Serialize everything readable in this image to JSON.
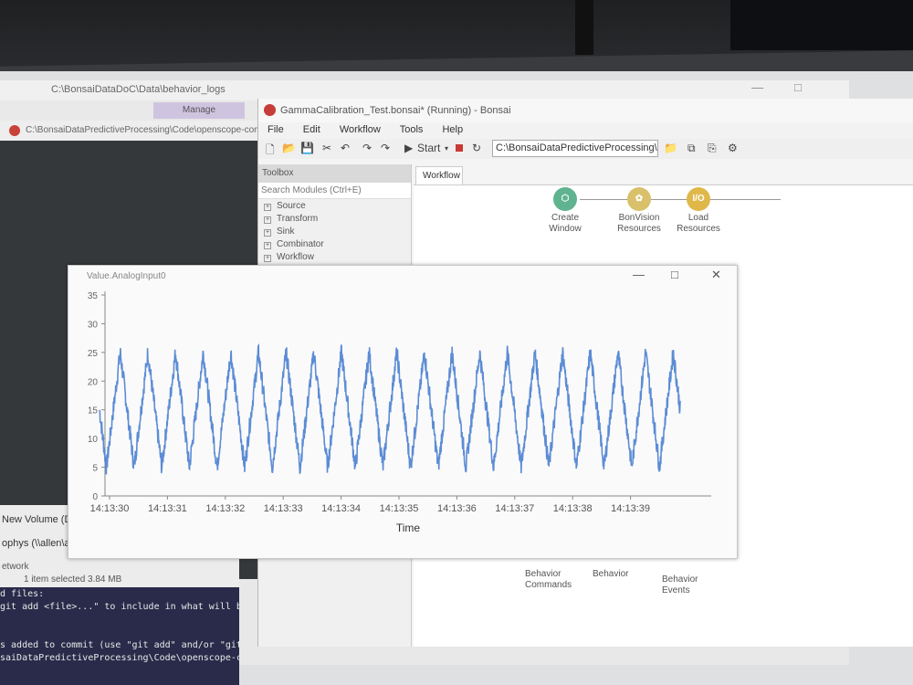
{
  "explorer_back": {
    "path": "C:\\BonsaiDataDoC\\Data\\behavior_logs",
    "manage_tab": "Manage"
  },
  "vscode": {
    "title": "C:\\BonsaiDataPredictiveProcessing\\Code\\openscope-comm"
  },
  "left_panel": {
    "volume": "New Volume (D:",
    "share": "ophys (\\\\allen\\a",
    "network": "etwork",
    "status": "1 item selected  3.84 MB"
  },
  "terminal": {
    "lines": [
      "d files:",
      "git add <file>...\" to include in what will be",
      "",
      "s added to commit (use \"git add\" and/or \"git",
      "saiDataPredictiveProcessing\\Code\\openscope-c"
    ]
  },
  "bonsai": {
    "title": "GammaCalibration_Test.bonsai* (Running) - Bonsai",
    "menu": [
      "File",
      "Edit",
      "Workflow",
      "Tools",
      "Help"
    ],
    "start_label": "Start",
    "path": "C:\\BonsaiDataPredictiveProcessing\\C",
    "toolbox_header": "Toolbox",
    "search_placeholder": "Search Modules (Ctrl+E)",
    "toolbox_items": [
      "Source",
      "Transform",
      "Sink",
      "Combinator",
      "Workflow"
    ],
    "tab": "Workflow",
    "nodes": [
      {
        "label1": "Create",
        "label2": "Window",
        "color": "#5fb38e",
        "glyph": "⬡"
      },
      {
        "label1": "BonVision",
        "label2": "Resources",
        "color": "#d9c06a",
        "glyph": "✿"
      },
      {
        "label1": "Load",
        "label2": "Resources",
        "color": "#e0b84a",
        "glyph": "I/O"
      }
    ],
    "bottom_nodes": [
      {
        "label1": "Behavior",
        "label2": "Commands"
      },
      {
        "label1": "Behavior",
        "label2": ""
      },
      {
        "label1": "Behavior",
        "label2": "Events"
      }
    ]
  },
  "chart_window": {
    "title": "Value.AnalogInput0"
  },
  "chart_data": {
    "type": "line",
    "title": "",
    "xlabel": "Time",
    "ylabel": "",
    "ylim": [
      0,
      35
    ],
    "yticks": [
      0,
      5,
      10,
      15,
      20,
      25,
      30,
      35
    ],
    "xticks": [
      "14:13:30",
      "14:13:31",
      "14:13:32",
      "14:13:33",
      "14:13:34",
      "14:13:35",
      "14:13:36",
      "14:13:37",
      "14:13:38",
      "14:13:39"
    ],
    "series_color": "#4a7fd0",
    "cycles": 21,
    "peak": 25,
    "trough": 5,
    "grid": false
  }
}
